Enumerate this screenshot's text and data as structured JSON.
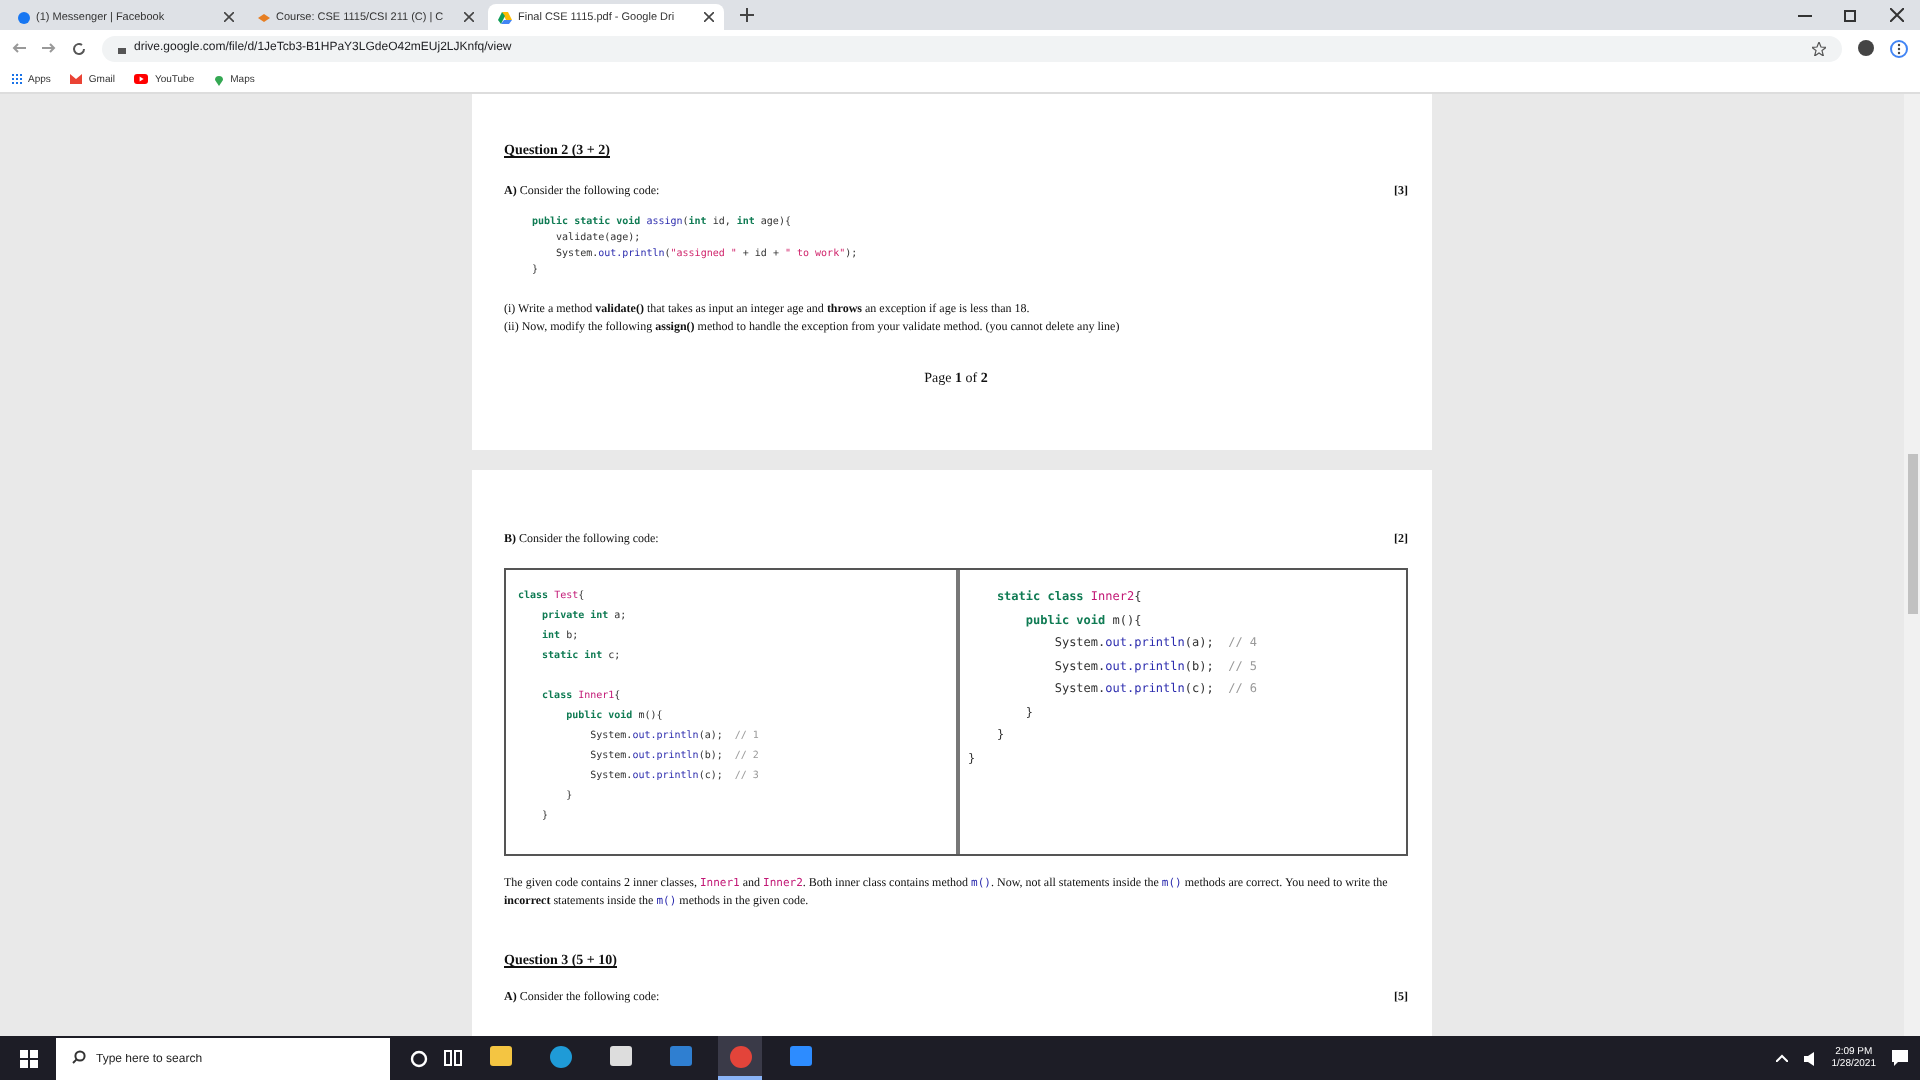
{
  "browser": {
    "tabs": [
      {
        "title": "(1) Messenger | Facebook",
        "selected": false
      },
      {
        "title": "Course: CSE 1115/CSI 211 (C) | C",
        "selected": false
      },
      {
        "title": "Final CSE 1115.pdf - Google Dri",
        "selected": true
      }
    ],
    "address": "drive.google.com/file/d/1JeTcb3-B1HPaY3LGdeO42mEUj2LJKnfq/view",
    "bookmarks": [
      {
        "label": "Apps"
      },
      {
        "label": "Gmail"
      },
      {
        "label": "YouTube"
      },
      {
        "label": "Maps"
      }
    ]
  },
  "page1": {
    "heading": "Question 2 (3 + 2)",
    "part_label": "A)",
    "part_text": "Consider the following code:",
    "marks": "[3]",
    "code": [
      [
        {
          "kind": "kw",
          "text": "public static void "
        },
        {
          "kind": "fn",
          "text": "assign"
        },
        {
          "kind": "plain",
          "text": "("
        },
        {
          "kind": "kw",
          "text": "int"
        },
        {
          "kind": "plain",
          "text": " id, "
        },
        {
          "kind": "kw",
          "text": "int"
        },
        {
          "kind": "plain",
          "text": " age){"
        }
      ],
      [
        {
          "kind": "plain",
          "text": "    validate(age);"
        }
      ],
      [
        {
          "kind": "plain",
          "text": "    System."
        },
        {
          "kind": "fn",
          "text": "out.println"
        },
        {
          "kind": "plain",
          "text": "("
        },
        {
          "kind": "str",
          "text": "\"assigned \""
        },
        {
          "kind": "plain",
          "text": " + id + "
        },
        {
          "kind": "str",
          "text": "\" to work\""
        },
        {
          "kind": "plain",
          "text": ");"
        }
      ],
      [
        {
          "kind": "plain",
          "text": "}"
        }
      ]
    ],
    "tasks": [
      "(i) Write a method **validate()** that takes as input an integer age and **throws** an exception if age is less than 18.",
      "(ii) Now, modify the following **assign()** method to handle the exception from your validate method. (you cannot delete any line)"
    ],
    "footer": "Page **1** of **2**"
  },
  "page2": {
    "part_label": "B)",
    "part_text": "Consider the following code:",
    "marks": "[2]",
    "code_left": [
      [
        [
          {
            "kind": "kw",
            "text": "class "
          },
          {
            "kind": "cls",
            "text": "Test"
          },
          {
            "kind": "plain",
            "text": "{"
          }
        ],
        [
          {
            "kind": "kw",
            "text": "    private int "
          },
          {
            "kind": "plain",
            "text": "a;"
          }
        ],
        [
          {
            "kind": "kw",
            "text": "    int "
          },
          {
            "kind": "plain",
            "text": "b;"
          }
        ],
        [
          {
            "kind": "kw",
            "text": "    static int "
          },
          {
            "kind": "plain",
            "text": "c;"
          }
        ]
      ],
      [
        [
          {
            "kind": "kw",
            "text": "    class "
          },
          {
            "kind": "cls",
            "text": "Inner1"
          },
          {
            "kind": "plain",
            "text": "{"
          }
        ],
        [
          {
            "kind": "kw",
            "text": "        public void "
          },
          {
            "kind": "plain",
            "text": "m(){"
          }
        ],
        [
          {
            "kind": "plain",
            "text": "            System."
          },
          {
            "kind": "fn",
            "text": "out.println"
          },
          {
            "kind": "plain",
            "text": "(a);  "
          },
          {
            "kind": "cmt",
            "text": "// 1"
          }
        ],
        [
          {
            "kind": "plain",
            "text": "            System."
          },
          {
            "kind": "fn",
            "text": "out.println"
          },
          {
            "kind": "plain",
            "text": "(b);  "
          },
          {
            "kind": "cmt",
            "text": "// 2"
          }
        ],
        [
          {
            "kind": "plain",
            "text": "            System."
          },
          {
            "kind": "fn",
            "text": "out.println"
          },
          {
            "kind": "plain",
            "text": "(c);  "
          },
          {
            "kind": "cmt",
            "text": "// 3"
          }
        ],
        [
          {
            "kind": "plain",
            "text": "        }"
          }
        ],
        [
          {
            "kind": "plain",
            "text": "    }"
          }
        ]
      ]
    ],
    "code_right": [
      [
        {
          "kind": "kw",
          "text": "    static class "
        },
        {
          "kind": "cls",
          "text": "Inner2"
        },
        {
          "kind": "plain",
          "text": "{"
        }
      ],
      [
        {
          "kind": "kw",
          "text": "        public void "
        },
        {
          "kind": "plain",
          "text": "m(){"
        }
      ],
      [
        {
          "kind": "plain",
          "text": "            System."
        },
        {
          "kind": "fn",
          "text": "out.println"
        },
        {
          "kind": "plain",
          "text": "(a);  "
        },
        {
          "kind": "cmt",
          "text": "// 4"
        }
      ],
      [
        {
          "kind": "plain",
          "text": "            System."
        },
        {
          "kind": "fn",
          "text": "out.println"
        },
        {
          "kind": "plain",
          "text": "(b);  "
        },
        {
          "kind": "cmt",
          "text": "// 5"
        }
      ],
      [
        {
          "kind": "plain",
          "text": "            System."
        },
        {
          "kind": "fn",
          "text": "out.println"
        },
        {
          "kind": "plain",
          "text": "(c);  "
        },
        {
          "kind": "cmt",
          "text": "// 6"
        }
      ],
      [
        {
          "kind": "plain",
          "text": "        }"
        }
      ],
      [
        {
          "kind": "plain",
          "text": "    }"
        }
      ],
      [
        {
          "kind": "plain",
          "text": "}"
        }
      ]
    ],
    "description": [
      {
        "kind": "text",
        "text": "The given code contains 2 inner classes, "
      },
      {
        "kind": "code",
        "text": "Inner1"
      },
      {
        "kind": "text",
        "text": " and "
      },
      {
        "kind": "code",
        "text": "Inner2"
      },
      {
        "kind": "text",
        "text": ". Both inner class contains method "
      },
      {
        "kind": "call",
        "text": "m()"
      },
      {
        "kind": "text",
        "text": ". Now, not all statements inside the "
      },
      {
        "kind": "call",
        "text": "m()"
      },
      {
        "kind": "text",
        "text": " methods are correct. You need to write the "
      },
      {
        "kind": "bold",
        "text": "incorrect"
      },
      {
        "kind": "text",
        "text": " statements inside the "
      },
      {
        "kind": "call",
        "text": "m()"
      },
      {
        "kind": "text",
        "text": " methods in the given code."
      }
    ],
    "heading": "Question 3 (5 + 10)",
    "part2_label": "A)",
    "part2_text": "Consider the following code:",
    "marks2": "[5]"
  },
  "taskbar": {
    "search_placeholder": "Type here to search",
    "apps": [
      {
        "active": false
      },
      {
        "active": false
      },
      {
        "active": false
      },
      {
        "active": false
      },
      {
        "active": true
      },
      {
        "active": false
      }
    ],
    "time": "2:09 PM",
    "date": "1/28/2021"
  }
}
